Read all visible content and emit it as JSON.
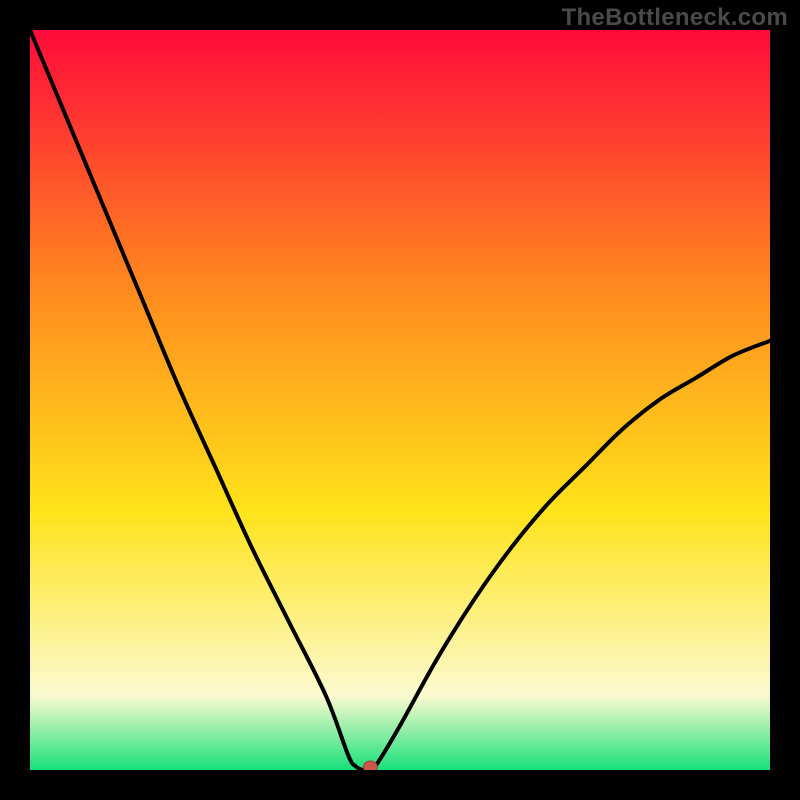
{
  "watermark": "TheBottleneck.com",
  "colors": {
    "frame": "#000000",
    "curve": "#000000",
    "marker_fill": "#c9594b",
    "marker_stroke": "#9e3e33",
    "gradient_top": "#ff0a3a",
    "gradient_mid1": "#ff8a1f",
    "gradient_mid2": "#ffe31a",
    "gradient_pale": "#fbfad0",
    "gradient_green": "#18e07a"
  },
  "chart_data": {
    "type": "line",
    "title": "",
    "xlabel": "",
    "ylabel": "",
    "xlim": [
      0,
      100
    ],
    "ylim": [
      0,
      100
    ],
    "series": [
      {
        "name": "bottleneck-curve",
        "x": [
          0,
          5,
          10,
          15,
          20,
          25,
          30,
          35,
          40,
          43,
          44,
          45,
          46,
          47,
          50,
          55,
          60,
          65,
          70,
          75,
          80,
          85,
          90,
          95,
          100
        ],
        "values": [
          100,
          88,
          76,
          64,
          52,
          41,
          30,
          20,
          10,
          2,
          0.5,
          0,
          0,
          1,
          6,
          15,
          23,
          30,
          36,
          41,
          46,
          50,
          53,
          56,
          58
        ]
      }
    ],
    "marker": {
      "x": 46,
      "y": 0
    }
  }
}
